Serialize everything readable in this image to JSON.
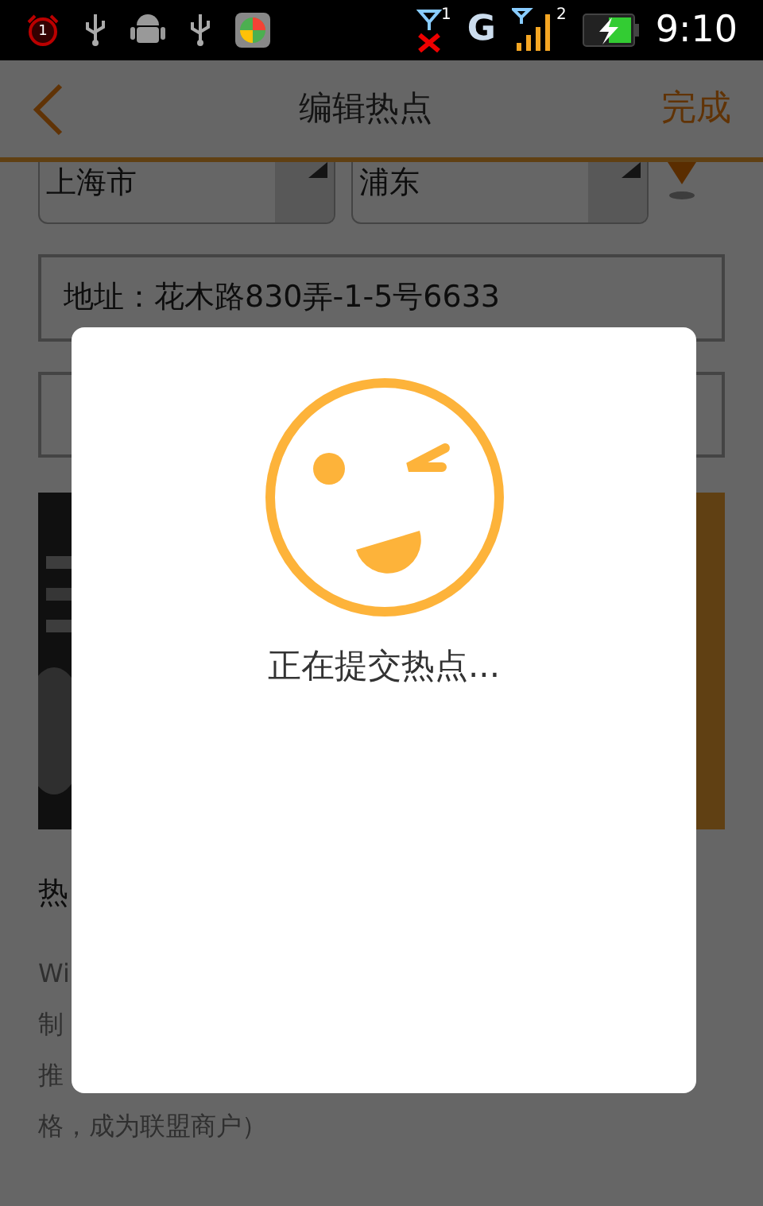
{
  "status_bar": {
    "alarm_count": "1",
    "sim1_label": "1",
    "network": "G",
    "sim2_label": "2",
    "time": "9:10"
  },
  "header": {
    "title": "编辑热点",
    "done": "完成"
  },
  "form": {
    "city": "上海市",
    "district": "浦东",
    "address": "地址：花木路830弄-1-5号6633"
  },
  "section_title": "热",
  "description_lines": [
    "Wi",
    "制",
    "推",
    "格，成为联盟商户）"
  ],
  "dialog": {
    "message": "正在提交热点..."
  }
}
